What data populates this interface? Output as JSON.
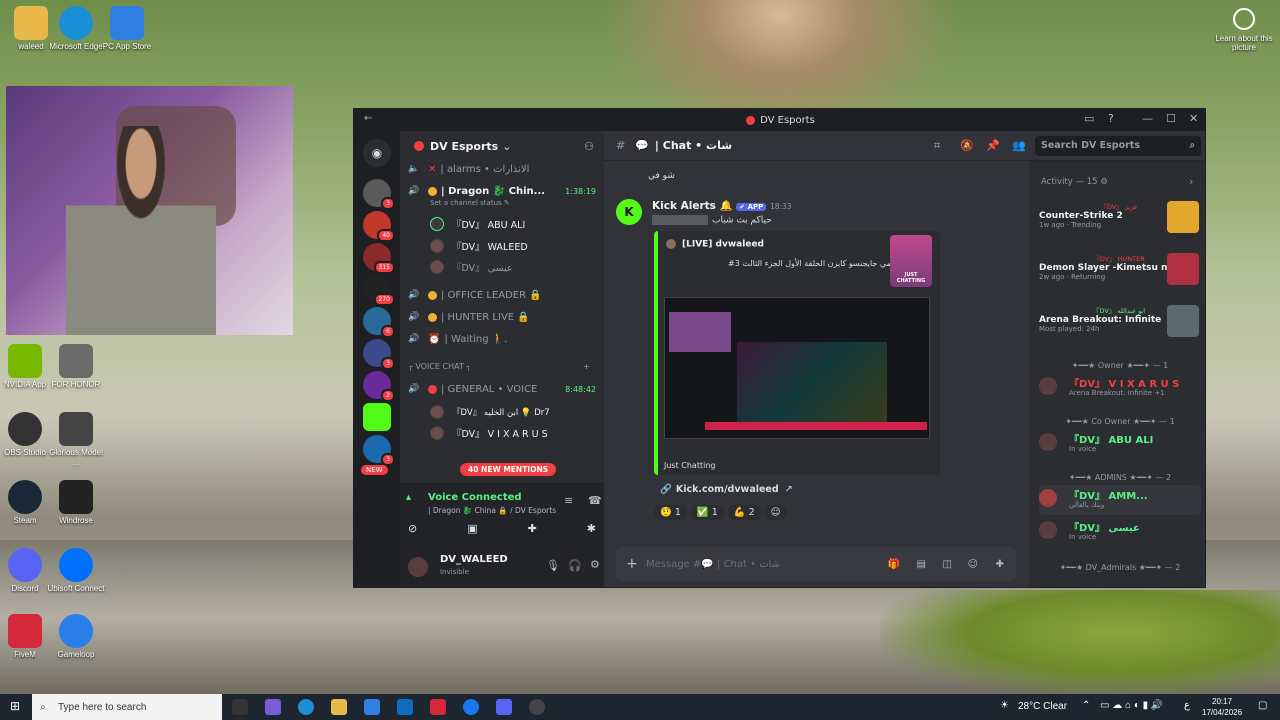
{
  "desktop": {
    "icons": [
      {
        "label": "waleed",
        "icon": "folder-icon",
        "color": "#e8b84a"
      },
      {
        "label": "Microsoft Edge",
        "icon": "edge-icon",
        "color": "#1b8fd6"
      },
      {
        "label": "PC App Store",
        "icon": "app-store-icon",
        "color": "#2e7fe0"
      },
      {
        "label": "NVIDIA App",
        "icon": "nvidia-icon",
        "color": "#76b900"
      },
      {
        "label": "FOR HONOR",
        "icon": "for-honor-icon",
        "color": "#6b6b6b"
      },
      {
        "label": "OBS Studio",
        "icon": "obs-icon",
        "color": "#333"
      },
      {
        "label": "Glorious Model ...",
        "icon": "glorious-icon",
        "color": "#444"
      },
      {
        "label": "Steam",
        "icon": "steam-icon",
        "color": "#1b2838"
      },
      {
        "label": "Windrose",
        "icon": "windrose-icon",
        "color": "#222"
      },
      {
        "label": "Discord",
        "icon": "discord-icon",
        "color": "#5865f2"
      },
      {
        "label": "Ubisoft Connect",
        "icon": "ubisoft-icon",
        "color": "#0070ff"
      },
      {
        "label": "FiveM",
        "icon": "fivem-icon",
        "color": "#d5283b"
      },
      {
        "label": "Gameloop",
        "icon": "gameloop-icon",
        "color": "#2b7de9"
      }
    ],
    "learn": "Learn about this picture"
  },
  "window": {
    "title": "DV Esports",
    "back": "←",
    "controls": [
      "—",
      "☐",
      "✕"
    ]
  },
  "server": {
    "name": "DV Esports",
    "channels": [
      {
        "name": "| alarms • الانذارات",
        "icon": "✕"
      },
      {
        "name": "| Dragon 🐉 Chin...",
        "time": "1:38:19",
        "sub": "Set a channel status ✎"
      },
      {
        "name": "| OFFICE LEADER 🔒"
      },
      {
        "name": "| HUNTER LIVE 🔒"
      },
      {
        "name": "| Waiting 🚶."
      }
    ],
    "voice_users": [
      "『DV』 ABU ALI",
      "『DV』 WALEED",
      "『DV』 عيسى"
    ],
    "category": "┌ VOICE CHAT ┐",
    "general": {
      "name": "| GENERAL • VOICE",
      "time": "8:48:42"
    },
    "general_users": [
      "『DV』 ابن الخليه 💡 Dr7",
      "『DV』 V I X A R U S"
    ],
    "mentions": "40 NEW MENTIONS",
    "new_label": "NEW"
  },
  "voice": {
    "status": "Voice Connected",
    "channel": "| Dragon 🐉 China 🔒 / DV Esports"
  },
  "user": {
    "name": "DV_WALEED",
    "status": "Invisible"
  },
  "channel_header": {
    "name": "| Chat • شات",
    "search_placeholder": "Search DV Esports"
  },
  "chat": {
    "prev_text": "شو في",
    "author": "Kick Alerts",
    "app_tag": "✔ APP",
    "time": "18:33",
    "body": "حياكم بث شباب",
    "embed_author": "[LIVE] dvwaleed",
    "embed_title": "#3 انمي جايجنسو كايزن الحلقة الأول الجزء الثالث",
    "embed_game": "Just Chatting",
    "thumb_label": "JUST CHATTING",
    "link": "Kick.com/dvwaleed",
    "reactions": [
      {
        "emoji": "🤨",
        "count": "1"
      },
      {
        "emoji": "✅",
        "count": "1"
      },
      {
        "emoji": "💪",
        "count": "2"
      }
    ],
    "composer_placeholder": "Message #💬 | Chat • شات"
  },
  "activity": {
    "header": "Activity — 15 ⚙",
    "items": [
      {
        "user": "『DV』 عزيز",
        "game": "Counter-Strike 2",
        "meta": "1w ago · Trending",
        "tile": "#e2a82e"
      },
      {
        "user": "『DV』 HUNTER",
        "game": "Demon Slayer -Kimetsu no ...",
        "meta": "2w ago · Returning",
        "tile": "#b03040"
      },
      {
        "user": "『DV』 ابو عبدالله",
        "game": "Arena Breakout: Infinite",
        "meta": "Most played: 24h",
        "tile": "#5a6a70"
      }
    ]
  },
  "members": [
    {
      "role": "✦━━★ Owner ★━━✦ — 1",
      "name": "『DV』 V I X A R U S",
      "status": "Arena Breakout: Infinite +1",
      "color": "#f23f43"
    },
    {
      "role": "✦━━★ Co Owner ★━━✦ — 1",
      "name": "『DV』 ABU ALI",
      "status": "In voice",
      "color": "#57f287"
    },
    {
      "role": "✦━━★ ADMINS ★━━✦ — 2",
      "name": "『DV』 AMM...",
      "status": "وينك يالغالي",
      "color": "#57f287"
    },
    {
      "role": "",
      "name": "『DV』 عيسى",
      "status": "In voice",
      "color": "#57f287"
    },
    {
      "role": "✦━━★ DV_Admirals ★━━✦ — 2",
      "name": "",
      "status": "",
      "color": "#57f287"
    }
  ],
  "taskbar": {
    "search": "Type here to search",
    "weather": "28°C  Clear",
    "time": "20:17",
    "date": "17/04/2026",
    "lang": "ع"
  }
}
